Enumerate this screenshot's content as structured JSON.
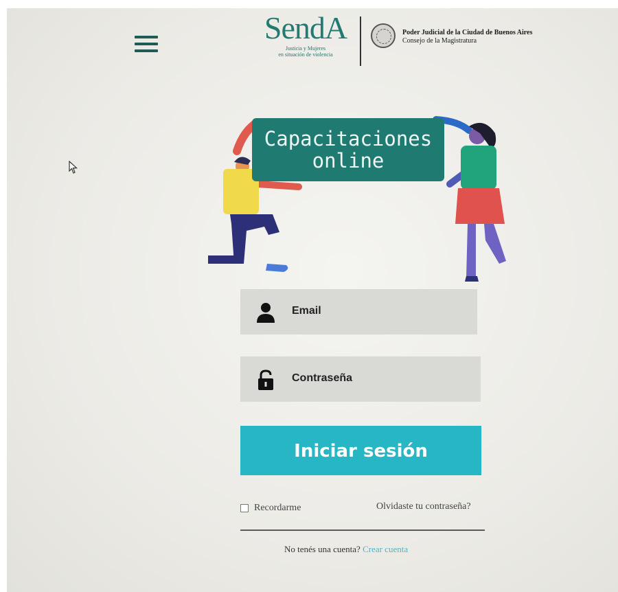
{
  "header": {
    "logo": {
      "main": "SendA",
      "line1": "Justicia y Mujeres",
      "line2": "en situación de violencia"
    },
    "org": {
      "line1": "Poder Judicial de la Ciudad de Buenos Aires",
      "line2": "Consejo de la Magistratura"
    },
    "menu_icon": "hamburger-menu-icon"
  },
  "illustration": {
    "banner_line1": "Capacitaciones",
    "banner_line2": "online"
  },
  "form": {
    "email_placeholder": "Email",
    "password_placeholder": "Contraseña",
    "login_label": "Iniciar sesión",
    "remember_label": "Recordarme",
    "forgot_label": "Olvidaste tu contraseña?",
    "no_account_text": "No tenés una cuenta?",
    "create_account_label": "Crear cuenta"
  },
  "colors": {
    "brand_teal": "#247a72",
    "banner_bg": "#1f7a72",
    "button_bg": "#26b6c4",
    "field_bg": "#d9d9d6",
    "link": "#4cb6c4"
  },
  "icons": {
    "email": "user-icon",
    "password": "unlock-icon",
    "cursor": "mouse-pointer-icon"
  }
}
